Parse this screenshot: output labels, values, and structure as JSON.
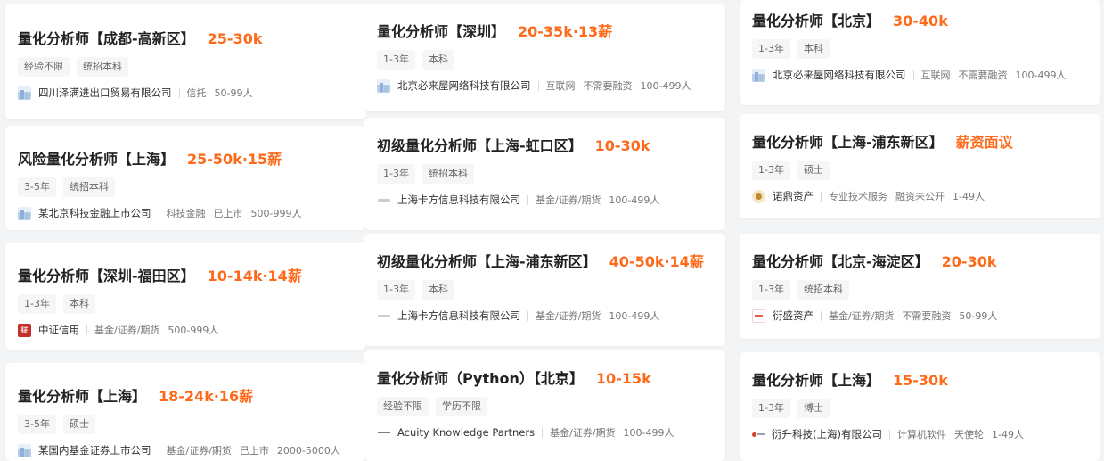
{
  "columns": [
    {
      "cards": [
        {
          "title": "量化分析师【成都-高新区】",
          "salary": "25-30k",
          "tags": [
            "经验不限",
            "统招本科"
          ],
          "logo": "building-icon",
          "company": "四川泽满进出口贸易有限公司",
          "meta": [
            "信托",
            "50-99人"
          ]
        },
        {
          "title": "风险量化分析师【上海】",
          "salary": "25-50k·15薪",
          "tags": [
            "3-5年",
            "统招本科"
          ],
          "logo": "building-icon",
          "company": "某北京科技金融上市公司",
          "meta": [
            "科技金融",
            "已上市",
            "500-999人"
          ]
        },
        {
          "title": "量化分析师【深圳-福田区】",
          "salary": "10-14k·14薪",
          "tags": [
            "1-3年",
            "本科"
          ],
          "logo": "zhongzheng-logo-icon",
          "company": "中证信用",
          "meta": [
            "基金/证券/期货",
            "500-999人"
          ]
        },
        {
          "title": "量化分析师【上海】",
          "salary": "18-24k·16薪",
          "tags": [
            "3-5年",
            "硕士"
          ],
          "logo": "building-icon",
          "company": "某国内基金证券上市公司",
          "meta": [
            "基金/证券/期货",
            "已上市",
            "2000-5000人"
          ]
        }
      ]
    },
    {
      "cards": [
        {
          "title": "量化分析师【深圳】",
          "salary": "20-35k·13薪",
          "tags": [
            "1-3年",
            "本科"
          ],
          "logo": "building-icon",
          "company": "北京必来屋网络科技有限公司",
          "meta": [
            "互联网",
            "不需要融资",
            "100-499人"
          ]
        },
        {
          "title": "初级量化分析师【上海-虹口区】",
          "salary": "10-30k",
          "tags": [
            "1-3年",
            "统招本科"
          ],
          "logo": "kafang-logo-icon",
          "company": "上海卡方信息科技有限公司",
          "meta": [
            "基金/证券/期货",
            "100-499人"
          ]
        },
        {
          "title": "初级量化分析师【上海-浦东新区】",
          "salary": "40-50k·14薪",
          "tags": [
            "1-3年",
            "本科"
          ],
          "logo": "kafang-logo-icon",
          "company": "上海卡方信息科技有限公司",
          "meta": [
            "基金/证券/期货",
            "100-499人"
          ]
        },
        {
          "title": "量化分析师（Python）【北京】",
          "salary": "10-15k",
          "tags": [
            "经验不限",
            "学历不限"
          ],
          "logo": "acuity-logo-icon",
          "company": "Acuity Knowledge Partners",
          "meta": [
            "基金/证券/期货",
            "100-499人"
          ]
        }
      ]
    },
    {
      "cards": [
        {
          "title": "量化分析师【北京】",
          "salary": "30-40k",
          "tags": [
            "1-3年",
            "本科"
          ],
          "logo": "building-icon",
          "company": "北京必来屋网络科技有限公司",
          "meta": [
            "互联网",
            "不需要融资",
            "100-499人"
          ]
        },
        {
          "title": "量化分析师【上海-浦东新区】",
          "salary": "薪资面议",
          "tags": [
            "1-3年",
            "硕士"
          ],
          "logo": "nuoding-logo-icon",
          "company": "诺鼎资产",
          "meta": [
            "专业技术服务",
            "融资未公开",
            "1-49人"
          ]
        },
        {
          "title": "量化分析师【北京-海淀区】",
          "salary": "20-30k",
          "tags": [
            "1-3年",
            "统招本科"
          ],
          "logo": "yansheng-logo-icon",
          "company": "衍盛资产",
          "meta": [
            "基金/证券/期货",
            "不需要融资",
            "50-99人"
          ]
        },
        {
          "title": "量化分析师【上海】",
          "salary": "15-30k",
          "tags": [
            "1-3年",
            "博士"
          ],
          "logo": "yansheng-tech-logo-icon",
          "company": "衍升科技(上海)有限公司",
          "meta": [
            "计算机软件",
            "天使轮",
            "1-49人"
          ]
        }
      ]
    }
  ]
}
